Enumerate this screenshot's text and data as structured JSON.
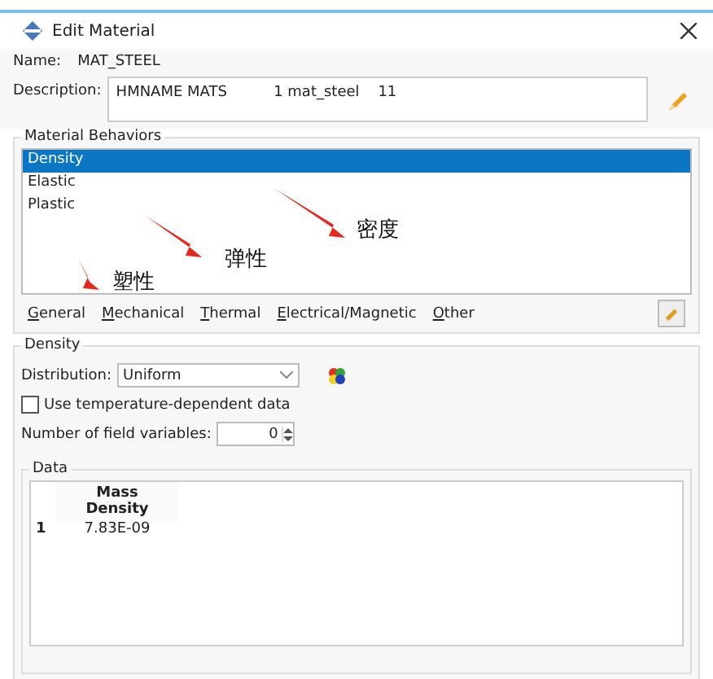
{
  "window": {
    "title": "Edit Material"
  },
  "name": {
    "label": "Name:",
    "value": "MAT_STEEL"
  },
  "description": {
    "label": "Description:",
    "value": "HMNAME MATS          1 mat_steel    11"
  },
  "behaviors": {
    "title": "Material Behaviors",
    "items": [
      {
        "label": "Density",
        "selected": true
      },
      {
        "label": "Elastic",
        "selected": false
      },
      {
        "label": "Plastic",
        "selected": false
      }
    ],
    "menus": [
      "General",
      "Mechanical",
      "Thermal",
      "Electrical/Magnetic",
      "Other"
    ]
  },
  "annotations": [
    {
      "text": "密度"
    },
    {
      "text": "弹性"
    },
    {
      "text": "塑性"
    }
  ],
  "density": {
    "title": "Density",
    "distribution_label": "Distribution:",
    "distribution": "Uniform",
    "temperature_dependent": {
      "label": "Use temperature-dependent data",
      "checked": false
    },
    "field_variables": {
      "label": "Number of field variables:",
      "value": "0"
    },
    "data": {
      "title": "Data",
      "columns": [
        "Mass Density"
      ],
      "rows": [
        {
          "index": "1",
          "cells": [
            "7.83E-09"
          ]
        }
      ]
    }
  }
}
